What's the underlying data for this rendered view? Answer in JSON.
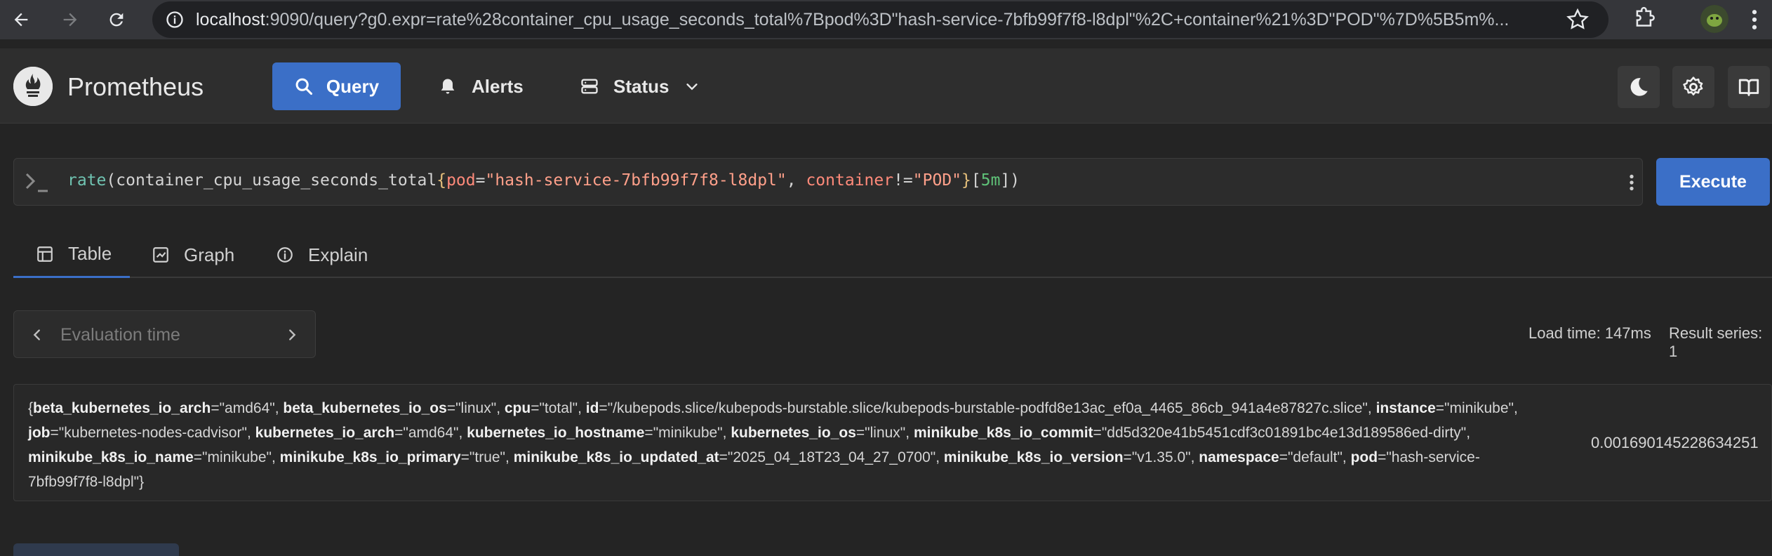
{
  "browser": {
    "url_host": "localhost",
    "url_rest": ":9090/query?g0.expr=rate%28container_cpu_usage_seconds_total%7Bpod%3D\"hash-service-7bfb99f7f8-l8dpl\"%2C+container%21%3D\"POD\"%7D%5B5m%..."
  },
  "header": {
    "brand": "Prometheus",
    "nav": {
      "query": "Query",
      "alerts": "Alerts",
      "status": "Status"
    }
  },
  "query": {
    "fn": "rate",
    "metric": "container_cpu_usage_seconds_total",
    "label1": "pod",
    "val1": "\"hash-service-7bfb99f7f8-l8dpl\"",
    "label2": "container",
    "op2": "!=",
    "val2": "\"POD\"",
    "duration": "5m",
    "execute": "Execute"
  },
  "tabs": {
    "table": "Table",
    "graph": "Graph",
    "explain": "Explain"
  },
  "eval": {
    "placeholder": "Evaluation time"
  },
  "stats": {
    "load_time": "Load time: 147ms",
    "result_series": "Result series: 1"
  },
  "result": {
    "labels": [
      {
        "k": "beta_kubernetes_io_arch",
        "v": "\"amd64\""
      },
      {
        "k": "beta_kubernetes_io_os",
        "v": "\"linux\""
      },
      {
        "k": "cpu",
        "v": "\"total\""
      },
      {
        "k": "id",
        "v": "\"/kubepods.slice/kubepods-burstable.slice/kubepods-burstable-podfd8e13ac_ef0a_4465_86cb_941a4e87827c.slice\""
      },
      {
        "k": "instance",
        "v": "\"minikube\""
      },
      {
        "k": "job",
        "v": "\"kubernetes-nodes-cadvisor\""
      },
      {
        "k": "kubernetes_io_arch",
        "v": "\"amd64\""
      },
      {
        "k": "kubernetes_io_hostname",
        "v": "\"minikube\""
      },
      {
        "k": "kubernetes_io_os",
        "v": "\"linux\""
      },
      {
        "k": "minikube_k8s_io_commit",
        "v": "\"dd5d320e41b5451cdf3c01891bc4e13d189586ed-dirty\""
      },
      {
        "k": "minikube_k8s_io_name",
        "v": "\"minikube\""
      },
      {
        "k": "minikube_k8s_io_primary",
        "v": "\"true\""
      },
      {
        "k": "minikube_k8s_io_updated_at",
        "v": "\"2025_04_18T23_04_27_0700\""
      },
      {
        "k": "minikube_k8s_io_version",
        "v": "\"v1.35.0\""
      },
      {
        "k": "namespace",
        "v": "\"default\""
      },
      {
        "k": "pod",
        "v": "\"hash-service-7bfb99f7f8-l8dpl\""
      }
    ],
    "value": "0.001690145228634251"
  }
}
